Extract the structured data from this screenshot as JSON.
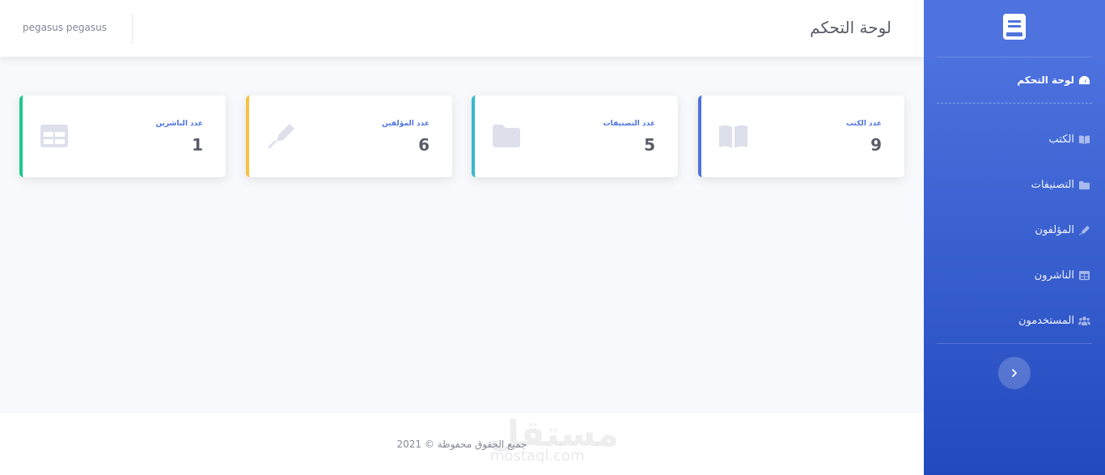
{
  "topbar": {
    "page_title": "لوحة التحكم",
    "user_name": "pegasus pegasus"
  },
  "sidebar": {
    "brand_icon": "book-icon",
    "items": [
      {
        "label": "لوحة التحكم",
        "icon": "dashboard-gauge-icon",
        "active": true
      },
      {
        "label": "الكتب",
        "icon": "book-open-icon"
      },
      {
        "label": "التصنيفات",
        "icon": "folder-icon"
      },
      {
        "label": "المؤلفون",
        "icon": "pen-icon"
      },
      {
        "label": "الناشرون",
        "icon": "table-icon"
      },
      {
        "label": "المستخدمون",
        "icon": "users-icon"
      }
    ],
    "toggle_icon": "chevron-right-icon"
  },
  "cards": [
    {
      "label": "عدد الكتب",
      "value": "9",
      "icon": "book-open-icon",
      "accent": "#4e73df"
    },
    {
      "label": "عدد التصنيفات",
      "value": "5",
      "icon": "folder-icon",
      "accent": "#36b9cc"
    },
    {
      "label": "عدد المؤلفين",
      "value": "6",
      "icon": "pen-icon",
      "accent": "#f6c23e"
    },
    {
      "label": "عدد الناشرين",
      "value": "1",
      "icon": "table-icon",
      "accent": "#1cc88a"
    }
  ],
  "footer": {
    "copyright": "جميع الحقوق محفوظة © 2021"
  },
  "watermark": {
    "text_ar": "مستقل",
    "text_en": "mostaql.com"
  },
  "colors": {
    "primary": "#4e73df",
    "primary_dark": "#224abe",
    "background": "#f8f9fc",
    "text_muted": "#858796"
  }
}
